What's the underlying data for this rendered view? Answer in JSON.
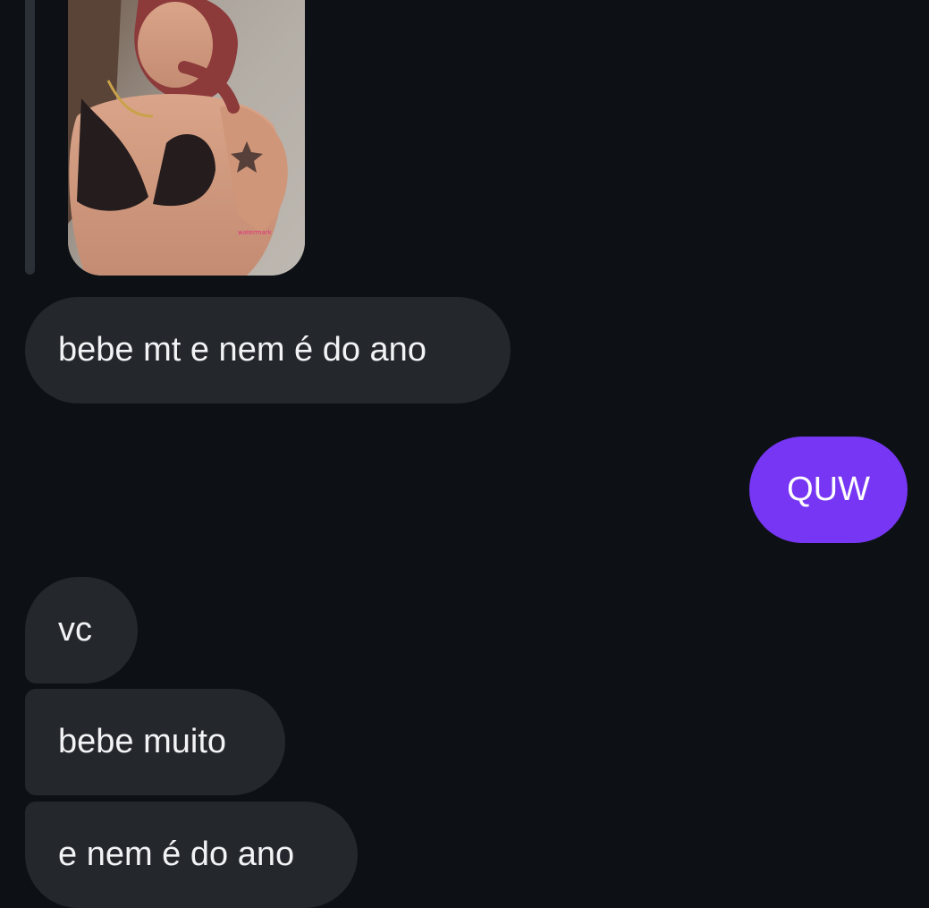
{
  "conversation": {
    "shared_media": {
      "description_icon": "photo-thumbnail"
    },
    "messages": [
      {
        "side": "received",
        "text": "bebe mt e nem é do ano"
      },
      {
        "side": "sent",
        "text": "QUW"
      },
      {
        "side": "received",
        "text": "vc"
      },
      {
        "side": "received",
        "text": "bebe muito"
      },
      {
        "side": "received",
        "text": "e nem é do ano"
      }
    ]
  },
  "colors": {
    "background": "#0d1116",
    "received_bubble": "#24282d",
    "sent_bubble": "#7636f3",
    "reply_bar": "#2b3036"
  }
}
